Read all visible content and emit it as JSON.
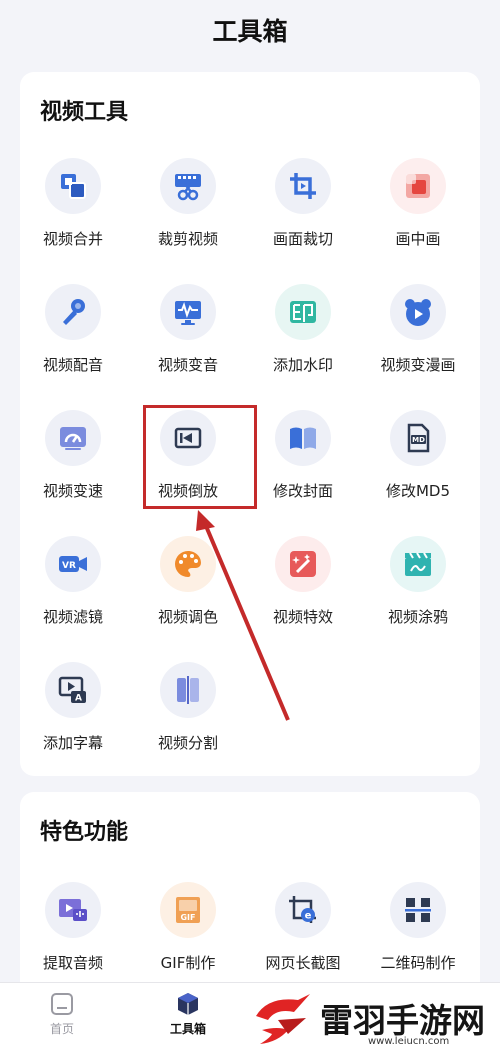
{
  "page_title": "工具箱",
  "sections": [
    {
      "title": "视频工具",
      "tools": [
        {
          "label": "视频合并",
          "icon": "merge-icon"
        },
        {
          "label": "裁剪视频",
          "icon": "film-scissors-icon"
        },
        {
          "label": "画面裁切",
          "icon": "crop-icon"
        },
        {
          "label": "画中画",
          "icon": "picture-in-picture-icon"
        },
        {
          "label": "视频配音",
          "icon": "microphone-icon"
        },
        {
          "label": "视频变音",
          "icon": "waveform-monitor-icon"
        },
        {
          "label": "添加水印",
          "icon": "stamp-icon"
        },
        {
          "label": "视频变漫画",
          "icon": "bear-play-icon"
        },
        {
          "label": "视频变速",
          "icon": "speedometer-icon"
        },
        {
          "label": "视频倒放",
          "icon": "reverse-play-icon"
        },
        {
          "label": "修改封面",
          "icon": "book-icon"
        },
        {
          "label": "修改MD5",
          "icon": "md-file-icon"
        },
        {
          "label": "视频滤镜",
          "icon": "vr-camera-icon"
        },
        {
          "label": "视频调色",
          "icon": "palette-icon"
        },
        {
          "label": "视频特效",
          "icon": "magic-wand-icon"
        },
        {
          "label": "视频涂鸦",
          "icon": "clapper-doodle-icon"
        },
        {
          "label": "添加字幕",
          "icon": "subtitle-icon"
        },
        {
          "label": "视频分割",
          "icon": "split-icon"
        }
      ]
    },
    {
      "title": "特色功能",
      "tools": [
        {
          "label": "提取音频",
          "icon": "extract-audio-icon"
        },
        {
          "label": "GIF制作",
          "icon": "gif-icon"
        },
        {
          "label": "网页长截图",
          "icon": "webpage-screenshot-icon"
        },
        {
          "label": "二维码制作",
          "icon": "qr-code-icon"
        }
      ]
    }
  ],
  "bottom_nav": {
    "home_label": "首页",
    "tools_label": "工具箱"
  },
  "watermark": {
    "name": "雷羽手游网",
    "url": "www.leiucn.com"
  },
  "colors": {
    "background": "#f3f4f9",
    "card": "#ffffff",
    "primary_blue": "#3a6fd8",
    "highlight_red": "#c42a2a"
  }
}
